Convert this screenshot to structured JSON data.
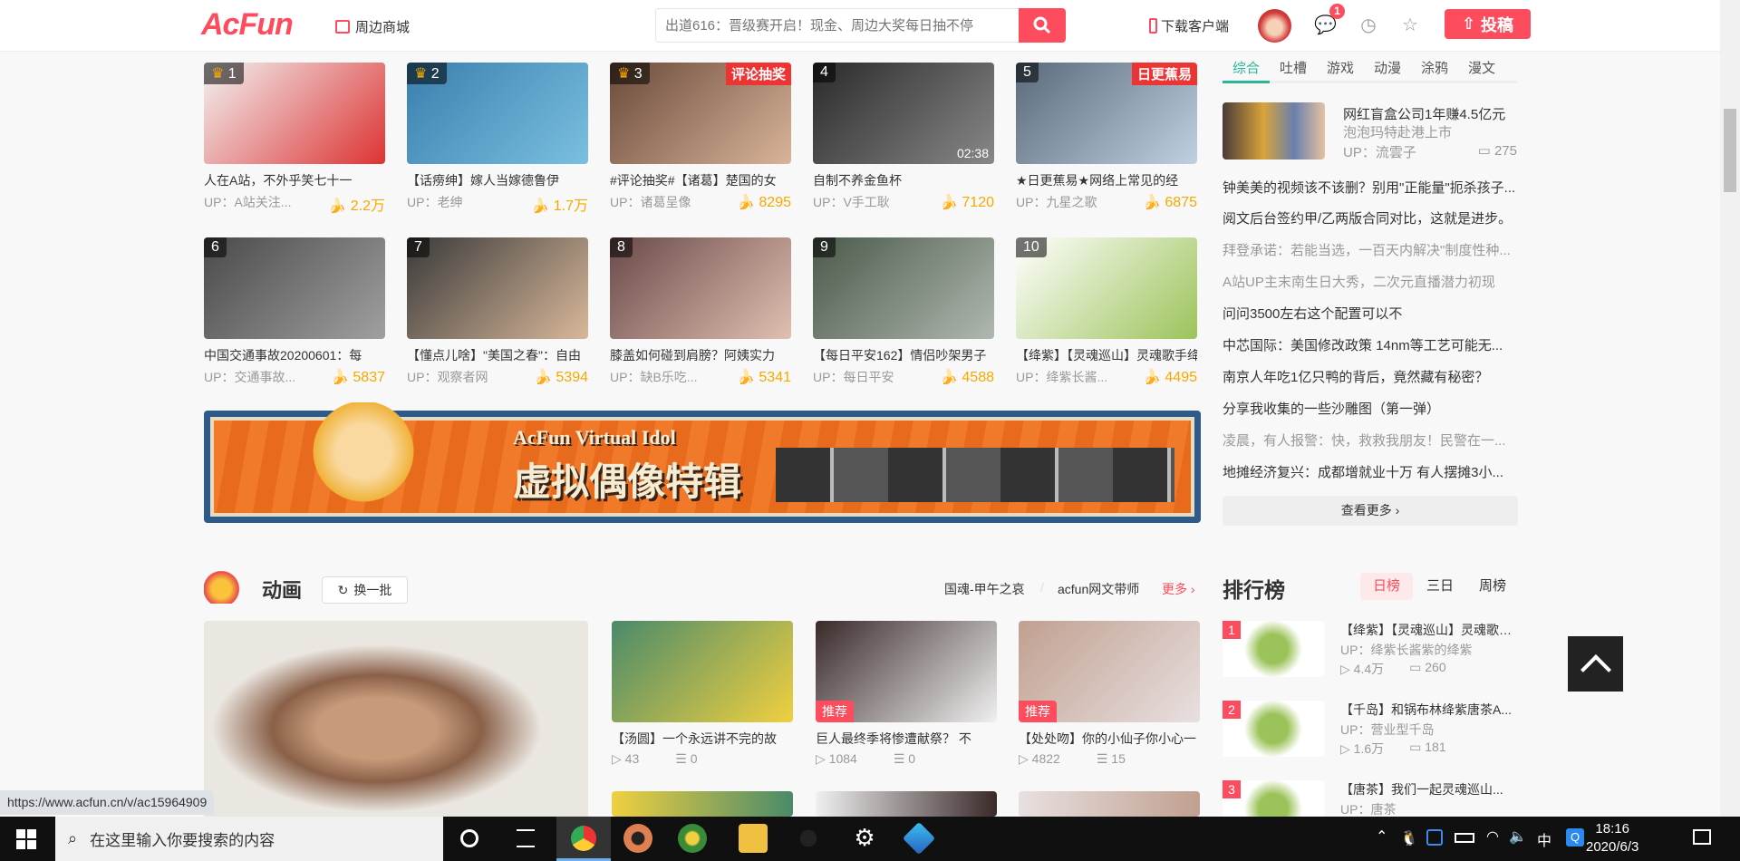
{
  "header": {
    "logo": "AcFun",
    "shop": "周边商城",
    "search_placeholder": "出道616：晋级赛开启！现金、周边大奖每日抽不停",
    "download": "下载客户端",
    "msg_badge": "1",
    "upload": "投稿"
  },
  "top_videos": [
    {
      "rank": "1",
      "title": "人在A站，不外乎笑七十一",
      "up": "UP：A站关注...",
      "bananas": "2.2万",
      "crown": true,
      "colors": [
        "#f2f2f2",
        "#d33"
      ]
    },
    {
      "rank": "2",
      "title": "【话痨绅】嫁人当嫁德鲁伊",
      "up": "UP：老绅",
      "bananas": "1.7万",
      "crown": true,
      "colors": [
        "#3a7fae",
        "#7ac0e0"
      ]
    },
    {
      "rank": "3",
      "title": "#评论抽奖#【诸葛】楚国的女",
      "up": "UP：诸葛呈像",
      "bananas": "8295",
      "crown": true,
      "tag": "评论抽奖",
      "colors": [
        "#6a4a3a",
        "#d9b49a"
      ]
    },
    {
      "rank": "4",
      "title": "自制不养金鱼杯",
      "up": "UP：V手工耿",
      "bananas": "7120",
      "duration": "02:38",
      "colors": [
        "#2a2a2a",
        "#888"
      ]
    },
    {
      "rank": "5",
      "title": "★日更蕉易★网络上常见的经",
      "up": "UP：九星之歌",
      "bananas": "6875",
      "tag": "日更蕉易",
      "colors": [
        "#5a6a7a",
        "#c0d0e0"
      ]
    },
    {
      "rank": "6",
      "title": "中国交通事故20200601：每",
      "up": "UP：交通事故...",
      "bananas": "5837",
      "colors": [
        "#4a4a4a",
        "#a0a0a0"
      ]
    },
    {
      "rank": "7",
      "title": "【懂点儿啥】\"美国之春\"：自由",
      "up": "UP：观察者网",
      "bananas": "5394",
      "colors": [
        "#3a3a3a",
        "#d9b89a"
      ]
    },
    {
      "rank": "8",
      "title": "膝盖如何碰到肩膀？阿姨实力",
      "up": "UP：缺B乐吃...",
      "bananas": "5341",
      "colors": [
        "#6a4a4a",
        "#e0c0b0"
      ]
    },
    {
      "rank": "9",
      "title": "【每日平安162】情侣吵架男子",
      "up": "UP：每日平安",
      "bananas": "4588",
      "colors": [
        "#4a5a4a",
        "#b0b8b0"
      ]
    },
    {
      "rank": "10",
      "title": "【绛紫】【灵魂巡山】灵魂歌手绛",
      "up": "UP：绛紫长酱...",
      "bananas": "4495",
      "colors": [
        "#fff",
        "#9cc35a"
      ]
    }
  ],
  "banner": {
    "en": "AcFun Virtual Idol",
    "cn": "虚拟偶像特辑"
  },
  "side": {
    "tabs": [
      "综合",
      "吐槽",
      "游戏",
      "动漫",
      "涂鸦",
      "漫文"
    ],
    "active_tab": 0,
    "top_news": {
      "title": "网红盲盒公司1年赚4.5亿元",
      "subtitle": "泡泡玛特赴港上市",
      "up": "UP：流雲子",
      "comments": "275"
    },
    "news": [
      {
        "text": "钟美美的视频该不该删？别用\"正能量\"扼杀孩子...",
        "read": false
      },
      {
        "text": "阅文后台签约甲/乙两版合同对比，这就是进步。",
        "read": false
      },
      {
        "text": "拜登承诺：若能当选，一百天内解决\"制度性种...",
        "read": true
      },
      {
        "text": "A站UP主末南生日大秀，二次元直播潜力初现",
        "read": true
      },
      {
        "text": "问问3500左右这个配置可以不",
        "read": false
      },
      {
        "text": "中芯国际：美国修改政策  14nm等工艺可能无...",
        "read": false
      },
      {
        "text": "南京人年吃1亿只鸭的背后，竟然藏有秘密？",
        "read": false
      },
      {
        "text": "分享我收集的一些沙雕图（第一弹）",
        "read": false
      },
      {
        "text": "凌晨，有人报警：快，救救我朋友！民警在一...",
        "read": true
      },
      {
        "text": "地摊经济复兴：成都增就业十万  有人摆摊3小...",
        "read": false
      }
    ],
    "more": "查看更多"
  },
  "anime": {
    "title": "动画",
    "refresh": "换一批",
    "links": [
      "国魂-甲午之哀",
      "acfun网文带师"
    ],
    "more": "更多",
    "videos": [
      {
        "title": "【汤圆】一个永远讲不完的故",
        "plays": "43",
        "danmaku": "0",
        "colors": [
          "#4a8a6a",
          "#f0d040"
        ]
      },
      {
        "title": "巨人最终季将惨遭献祭？  不",
        "plays": "1084",
        "danmaku": "0",
        "tag": "推荐",
        "colors": [
          "#3a2a2a",
          "#f0f0f0"
        ]
      },
      {
        "title": "【处处吻】你的小仙子你小心一",
        "plays": "4822",
        "danmaku": "15",
        "tag": "推荐",
        "colors": [
          "#c0a090",
          "#e8e0e0"
        ]
      }
    ]
  },
  "ranking": {
    "title": "排行榜",
    "tabs": [
      "日榜",
      "三日",
      "周榜"
    ],
    "active_tab": 0,
    "items": [
      {
        "no": "1",
        "title": "【绛紫】【灵魂巡山】灵魂歌手绛紫",
        "up": "UP：绛紫长酱紫的绛紫",
        "plays": "4.4万",
        "comments": "260"
      },
      {
        "no": "2",
        "title": "【千岛】和锅布林绛紫唐茶A...",
        "up": "UP：营业型千岛",
        "plays": "1.6万",
        "comments": "181"
      },
      {
        "no": "3",
        "title": "【唐茶】我们一起灵魂巡山...",
        "up": "UP：唐茶",
        "plays": "",
        "comments": ""
      }
    ]
  },
  "status_url": "https://www.acfun.cn/v/ac15964909",
  "taskbar": {
    "search_placeholder": "在这里输入你要搜索的内容",
    "ime": "中",
    "time": "18:16",
    "date": "2020/6/3"
  },
  "colors": {
    "accent": "#fd4c5d",
    "side_tab_active": "#2ab598",
    "banana": "#f7a800"
  }
}
